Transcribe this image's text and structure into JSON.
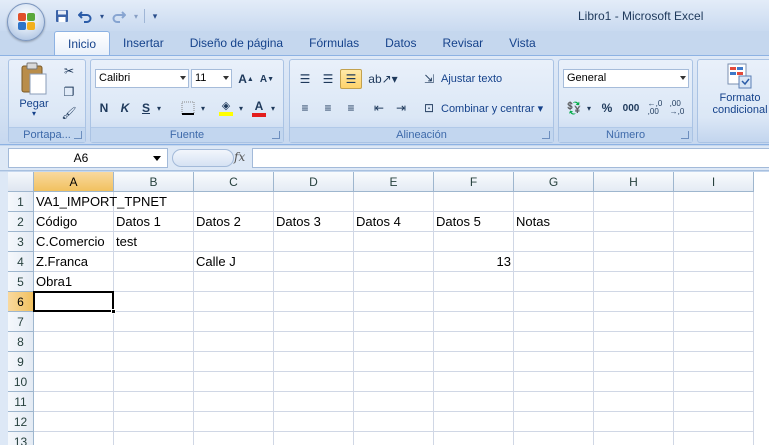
{
  "window": {
    "title": "Libro1 - Microsoft Excel"
  },
  "tabs": [
    "Inicio",
    "Insertar",
    "Diseño de página",
    "Fórmulas",
    "Datos",
    "Revisar",
    "Vista"
  ],
  "active_tab": "Inicio",
  "ribbon": {
    "clipboard": {
      "label": "Portapa...",
      "paste": "Pegar"
    },
    "font": {
      "label": "Fuente",
      "name": "Calibri",
      "size": "11",
      "bold": "N",
      "italic": "K",
      "underline": "S"
    },
    "alignment": {
      "label": "Alineación",
      "wrap": "Ajustar texto",
      "merge": "Combinar y centrar"
    },
    "number": {
      "label": "Número",
      "format": "General",
      "percent": "%",
      "thousands": "000",
      "dec_inc": "←,0 ,00",
      "dec_dec": ",00 →,0"
    },
    "styles": {
      "cond_format_line1": "Formato",
      "cond_format_line2": "condicional"
    }
  },
  "formula_bar": {
    "name_box": "A6",
    "fx": "fx",
    "content": ""
  },
  "columns": [
    "A",
    "B",
    "C",
    "D",
    "E",
    "F",
    "G",
    "H",
    "I"
  ],
  "rows": [
    "1",
    "2",
    "3",
    "4",
    "5",
    "6",
    "7",
    "8",
    "9",
    "10",
    "11",
    "12",
    "13"
  ],
  "selected_column": "A",
  "selected_row": "6",
  "cells": {
    "A1": "VA1_IMPORT_TPNET",
    "A2": "Código",
    "B2": "Datos 1",
    "C2": "Datos 2",
    "D2": "Datos 3",
    "E2": "Datos 4",
    "F2": "Datos 5",
    "G2": "Notas",
    "A3": "C.Comercio",
    "B3": "test",
    "A4": "Z.Franca",
    "C4": "Calle J",
    "F4": "13",
    "A5": "Obra1"
  },
  "icons": {
    "qat": [
      "save-icon",
      "undo-icon",
      "redo-icon",
      "customize-qat-icon"
    ],
    "clipboard": [
      "paste-icon",
      "cut-icon",
      "copy-icon",
      "format-painter-icon"
    ]
  },
  "colors": {
    "accent": "#15428b",
    "selection": "#f1c15f",
    "ribbon": "#dbe7f6"
  }
}
